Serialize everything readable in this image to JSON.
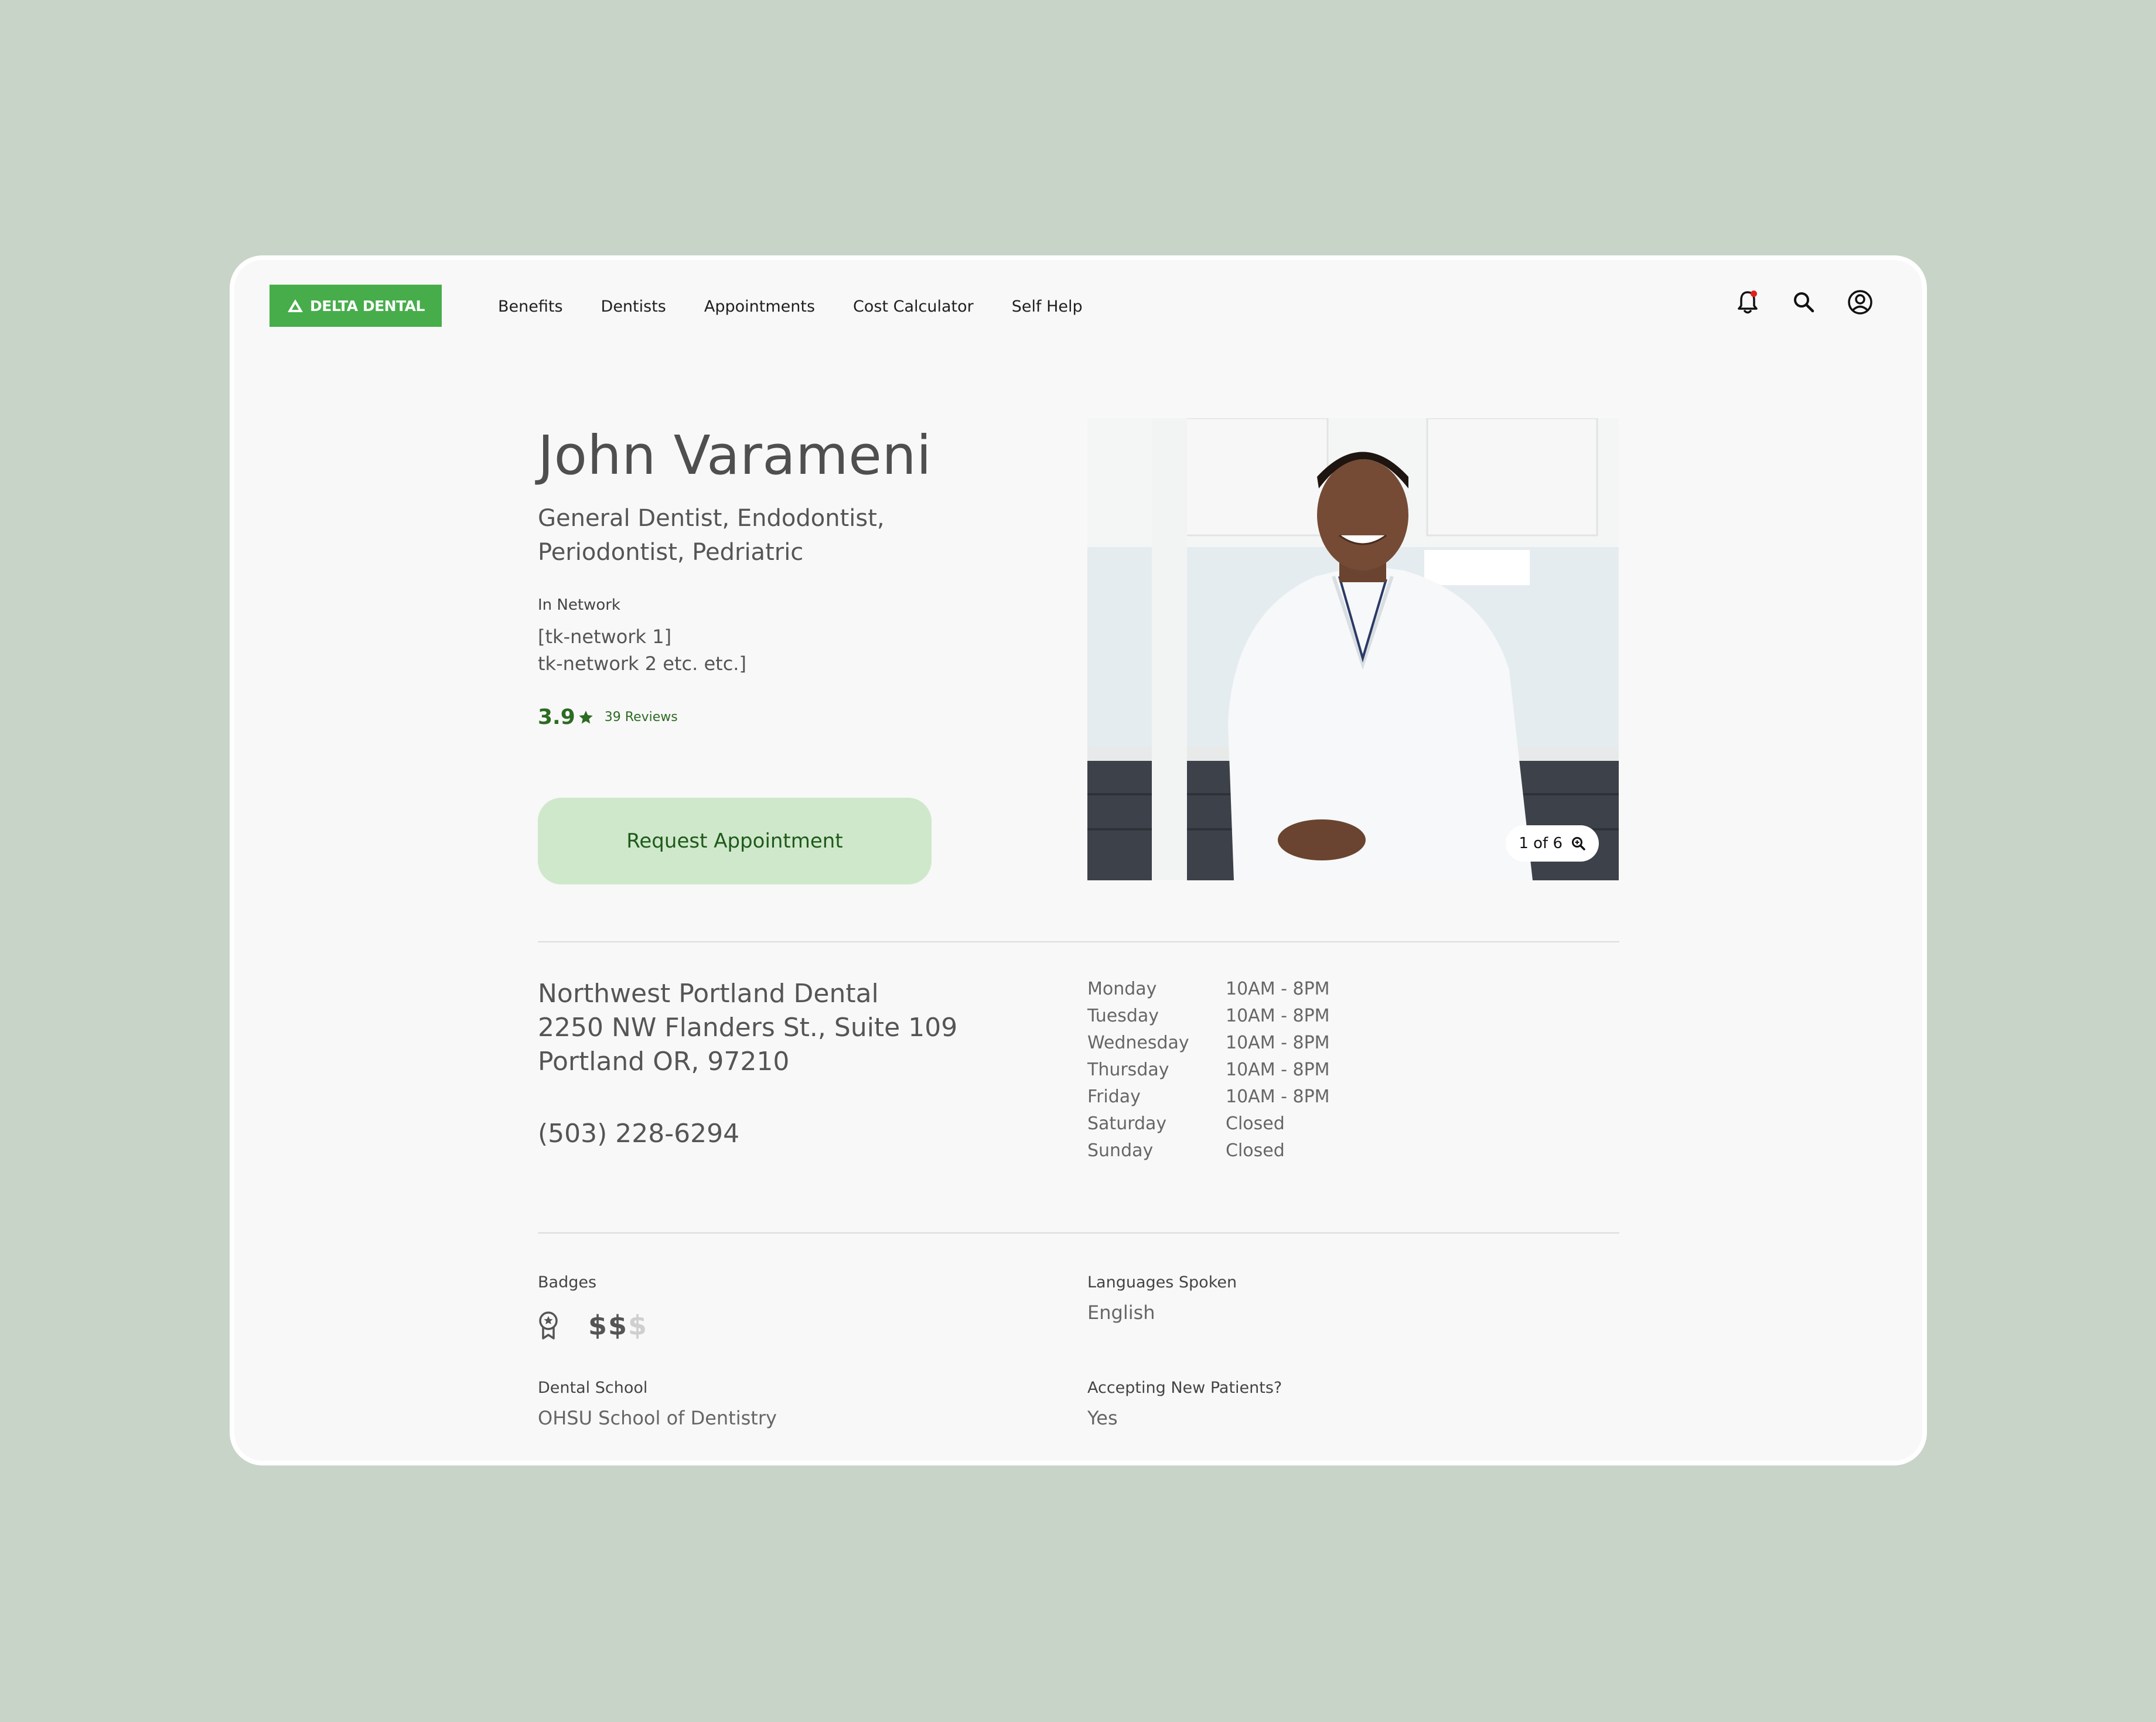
{
  "brand": {
    "logo_text": "DELTA DENTAL",
    "color": "#46ad4a"
  },
  "nav": {
    "items": [
      "Benefits",
      "Dentists",
      "Appointments",
      "Cost Calculator",
      "Self Help"
    ]
  },
  "header_icons": [
    "bell-icon",
    "search-icon",
    "account-icon"
  ],
  "profile": {
    "name": "John Varameni",
    "specialties": "General Dentist, Endodontist, Periodontist, Pedriatric",
    "network_label": "In Network",
    "networks": [
      "[tk-network 1]",
      "tk-network 2 etc. etc.]"
    ],
    "rating": "3.9",
    "reviews": "39 Reviews",
    "cta": "Request Appointment"
  },
  "photo": {
    "counter": "1 of 6"
  },
  "location": {
    "practice": "Northwest Portland Dental",
    "street": "2250 NW Flanders St., Suite 109",
    "city": "Portland OR, 97210",
    "phone": "(503) 228-6294"
  },
  "hours": [
    {
      "day": "Monday",
      "time": "10AM - 8PM"
    },
    {
      "day": "Tuesday",
      "time": "10AM - 8PM"
    },
    {
      "day": "Wednesday",
      "time": "10AM - 8PM"
    },
    {
      "day": "Thursday",
      "time": "10AM - 8PM"
    },
    {
      "day": "Friday",
      "time": "10AM - 8PM"
    },
    {
      "day": "Saturday",
      "time": "Closed"
    },
    {
      "day": "Sunday",
      "time": "Closed"
    }
  ],
  "details": {
    "badges_label": "Badges",
    "price_active": "$$",
    "price_inactive": "$",
    "languages_label": "Languages Spoken",
    "languages": "English",
    "school_label": "Dental School",
    "school": "OHSU School of Dentistry",
    "accepting_label": "Accepting New Patients?",
    "accepting": "Yes"
  }
}
